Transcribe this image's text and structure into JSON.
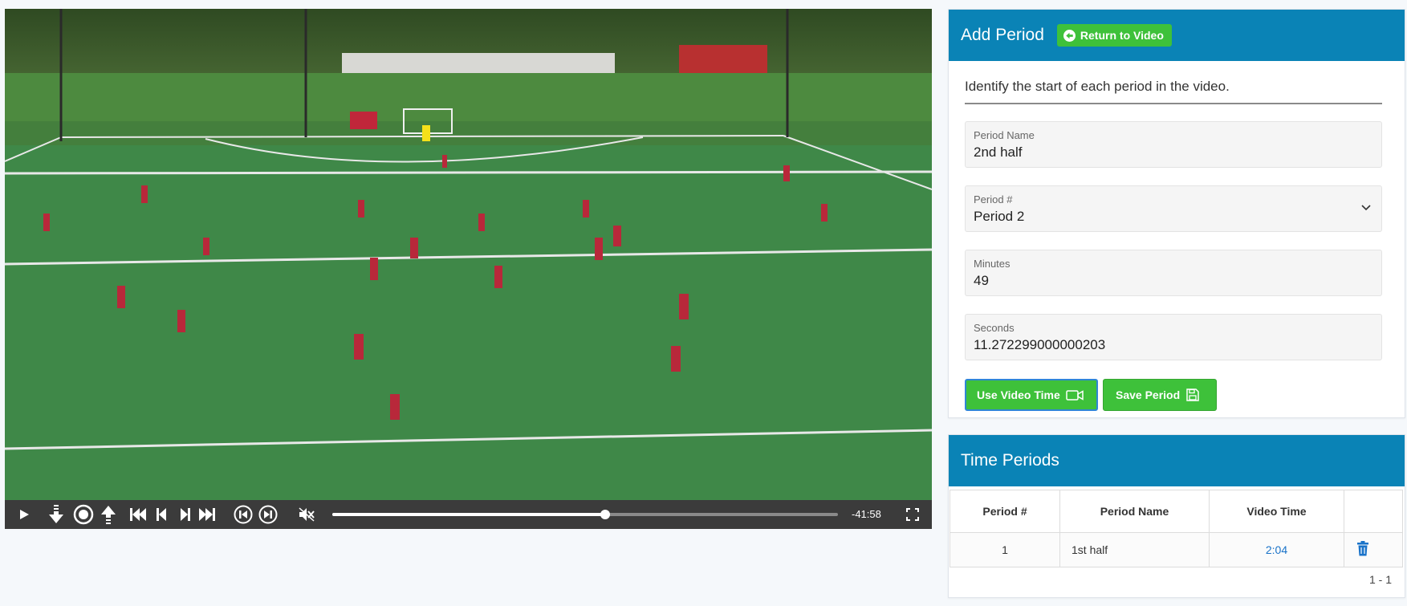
{
  "video": {
    "time_remaining": "-41:58",
    "progress_percent": 54,
    "icons": [
      "play-icon",
      "step-down-icon",
      "record-icon",
      "step-up-icon",
      "skip-start-icon",
      "frame-back-icon",
      "frame-forward-icon",
      "skip-end-icon",
      "rewind-seconds-icon",
      "forward-seconds-icon",
      "mute-icon",
      "fullscreen-icon"
    ]
  },
  "add_period": {
    "title": "Add Period",
    "return_label": "Return to Video",
    "intro": "Identify the start of each period in the video.",
    "period_name_label": "Period Name",
    "period_name_value": "2nd half",
    "period_number_label": "Period #",
    "period_number_value": "Period 2",
    "minutes_label": "Minutes",
    "minutes_value": "49",
    "seconds_label": "Seconds",
    "seconds_value": "11.272299000000203",
    "use_video_time_label": "Use Video Time",
    "save_period_label": "Save Period"
  },
  "time_periods": {
    "title": "Time Periods",
    "columns": [
      "Period #",
      "Period Name",
      "Video Time",
      ""
    ],
    "rows": [
      {
        "number": "1",
        "name": "1st half",
        "video_time": "2:04"
      }
    ],
    "pager": "1 - 1"
  },
  "colors": {
    "header_blue": "#0a83b6",
    "button_green": "#3ec13a",
    "link_blue": "#1a73c9",
    "field_turf": "#3f8848"
  }
}
